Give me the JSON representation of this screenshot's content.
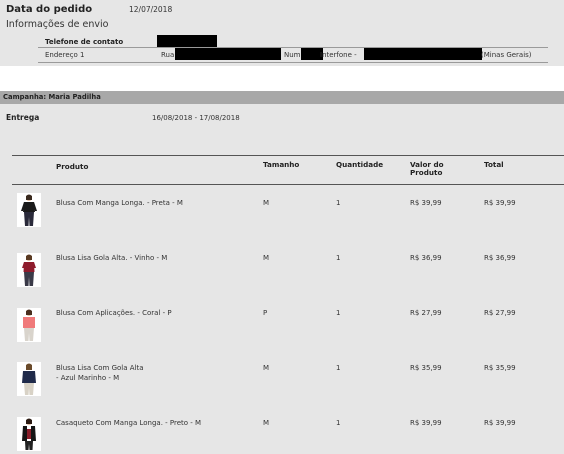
{
  "order": {
    "date_label": "Data do pedido",
    "date_value": "12/07/2018"
  },
  "shipping": {
    "title": "Informações de envio",
    "phone_label": "Telefone de contato",
    "address_label": "Endereço 1",
    "address_street_prefix": "Rua",
    "address_number_prefix": "Num",
    "address_intercom_prefix": "Interfone -",
    "address_state": "(Minas Gerais)"
  },
  "campaign": {
    "title": "Campanha: Maria Padilha",
    "delivery_label": "Entrega",
    "delivery_value": "16/08/2018 - 17/08/2018"
  },
  "table": {
    "headers": {
      "product": "Produto",
      "size": "Tamanho",
      "quantity": "Quantidade",
      "product_value": "Valor do Produto",
      "total": "Total"
    },
    "rows": [
      {
        "name": "Blusa Com Manga Longa. - Preta - M",
        "size": "M",
        "qty": "1",
        "price": "R$ 39,99",
        "total": "R$ 39,99",
        "top_color": "#1a1a1a",
        "bottom_color": "#2a2a3a"
      },
      {
        "name": "Blusa Lisa Gola Alta. - Vinho - M",
        "size": "M",
        "qty": "1",
        "price": "R$ 36,99",
        "total": "R$ 36,99",
        "top_color": "#8e1b2c",
        "bottom_color": "#3a3a48"
      },
      {
        "name": "Blusa Com Aplicações. - Coral - P",
        "size": "P",
        "qty": "1",
        "price": "R$ 27,99",
        "total": "R$ 27,99",
        "top_color": "#f07a7a",
        "bottom_color": "#d9d4cc"
      },
      {
        "name_line1": "Blusa Lisa Com Gola Alta",
        "name_line2": "- Azul Marinho - M",
        "size": "M",
        "qty": "1",
        "price": "R$ 35,99",
        "total": "R$ 35,99",
        "top_color": "#1f2a4a",
        "bottom_color": "#d8d2c6"
      },
      {
        "name": "Casaqueto Com Manga Longa. - Preto - M",
        "size": "M",
        "qty": "1",
        "price": "R$ 39,99",
        "total": "R$ 39,99",
        "top_color": "#151515",
        "bottom_color": "#8a1e2a"
      }
    ]
  }
}
